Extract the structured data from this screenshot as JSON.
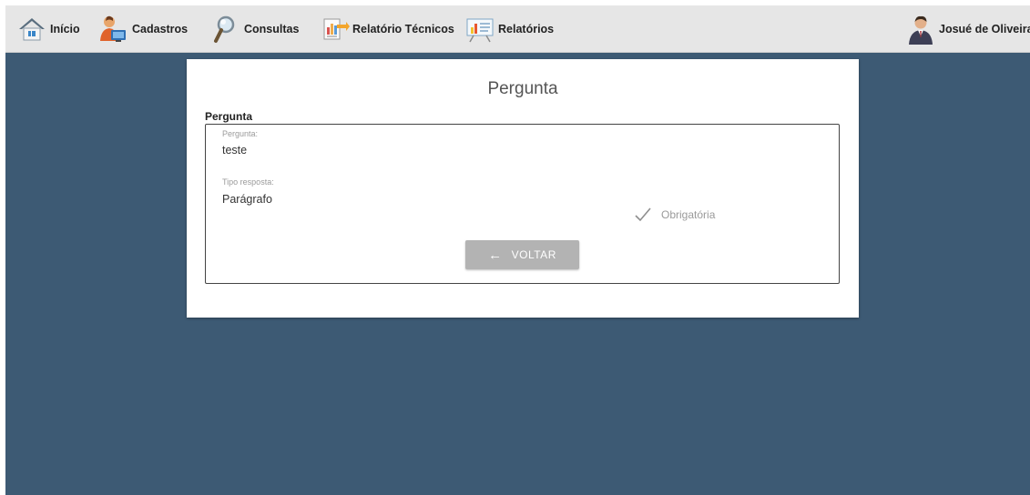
{
  "nav": {
    "items": [
      {
        "label": "Início",
        "icon": "home-icon"
      },
      {
        "label": "Cadastros",
        "icon": "register-user-icon"
      },
      {
        "label": "Consultas",
        "icon": "magnifier-icon"
      },
      {
        "label": "Relatório Técnicos",
        "icon": "technical-report-icon"
      },
      {
        "label": "Relatórios",
        "icon": "chart-board-icon"
      }
    ],
    "user": {
      "name": "Josué de Oliveira",
      "icon": "user-avatar-icon"
    }
  },
  "card": {
    "title": "Pergunta",
    "section_label": "Pergunta",
    "fields": {
      "pergunta": {
        "caption": "Pergunta:",
        "value": "teste"
      },
      "tipo_resposta": {
        "caption": "Tipo resposta:",
        "value": "Parágrafo"
      }
    },
    "obrigatoria": {
      "label": "Obrigatória",
      "checked": true,
      "icon": "check-icon"
    },
    "back_button": {
      "label": "VOLTAR",
      "icon": "arrow-left-icon"
    }
  },
  "colors": {
    "background": "#3d5a74",
    "navbar": "#e6e6e6",
    "card": "#ffffff",
    "button": "#b3b3b3"
  }
}
